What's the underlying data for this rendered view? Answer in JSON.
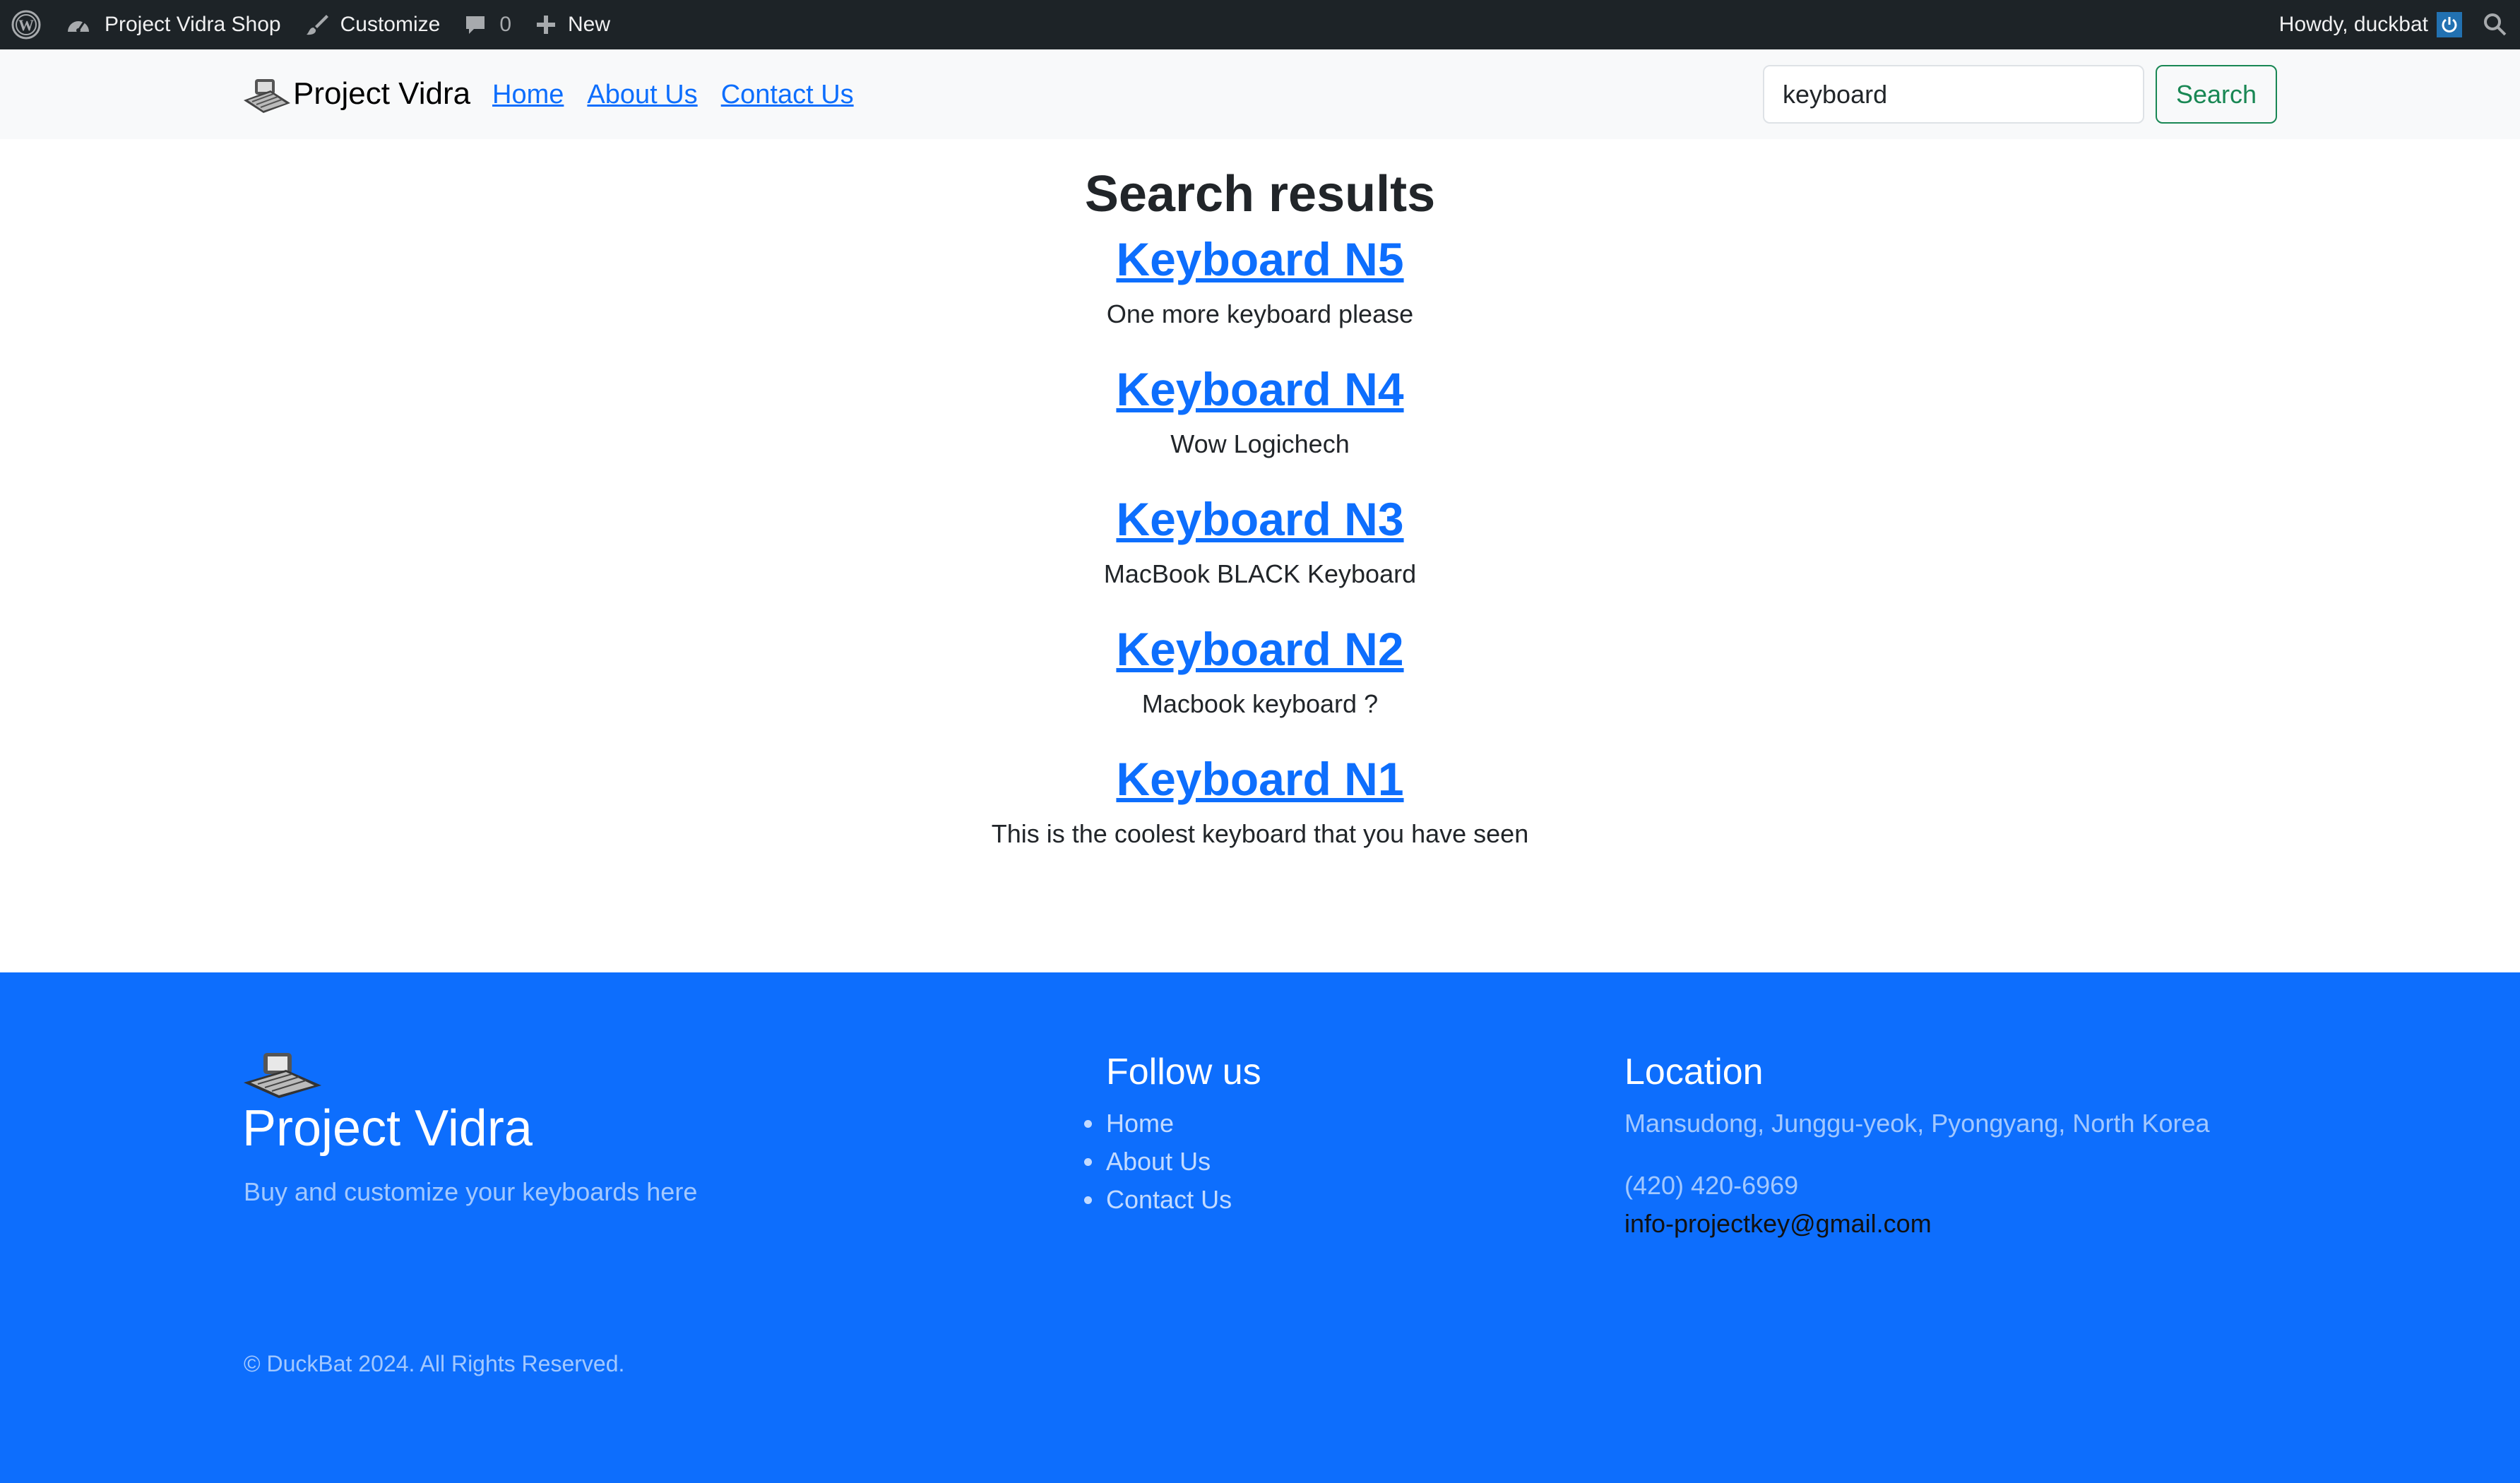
{
  "admin_bar": {
    "site_name": "Project Vidra Shop",
    "customize": "Customize",
    "comments_count": "0",
    "new": "New",
    "greeting": "Howdy, duckbat"
  },
  "navbar": {
    "brand": "Project Vidra",
    "links": [
      "Home",
      "About Us",
      "Contact Us"
    ],
    "search_value": "keyboard",
    "search_button": "Search"
  },
  "main": {
    "heading": "Search results",
    "results": [
      {
        "title": "Keyboard N5",
        "excerpt": "One more keyboard please"
      },
      {
        "title": "Keyboard N4",
        "excerpt": "Wow Logichech"
      },
      {
        "title": "Keyboard N3",
        "excerpt": "MacBook BLACK Keyboard"
      },
      {
        "title": "Keyboard N2",
        "excerpt": "Macbook keyboard ?"
      },
      {
        "title": "Keyboard N1",
        "excerpt": "This is the coolest keyboard that you have seen"
      }
    ]
  },
  "footer": {
    "title": "Project Vidra",
    "tagline": "Buy and customize your keyboards here",
    "follow_heading": "Follow us",
    "follow_links": [
      "Home",
      "About Us",
      "Contact Us"
    ],
    "location_heading": "Location",
    "address": "Mansudong, Junggu-yeok, Pyongyang, North Korea",
    "phone": "(420) 420-6969",
    "email": "info-projectkey@gmail.com",
    "copyright": "© DuckBat 2024. All Rights Reserved."
  },
  "colors": {
    "admin_bar_bg": "#1d2327",
    "primary": "#0d6efd",
    "success": "#198754",
    "navbar_bg": "#f8f9fa"
  },
  "icons": [
    "wordpress-icon",
    "dashboard-icon",
    "brush-icon",
    "comment-icon",
    "plus-icon",
    "power-icon",
    "search-icon",
    "keyboard-logo-icon"
  ]
}
